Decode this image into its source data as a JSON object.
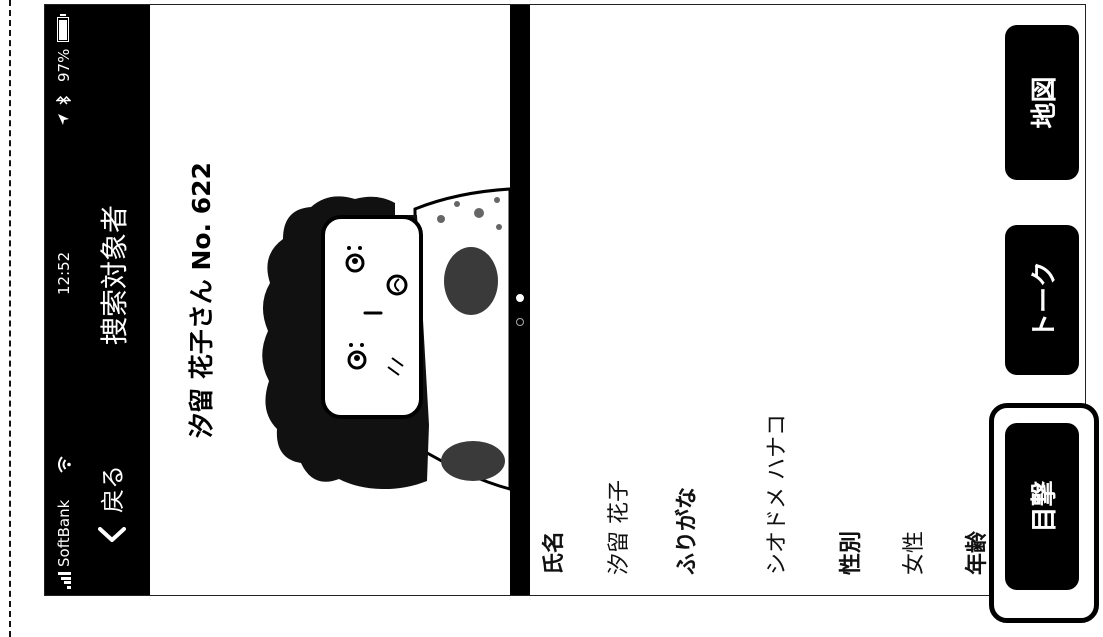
{
  "status_bar": {
    "carrier": "SoftBank",
    "time": "12:52",
    "battery_percent": "97%",
    "battery_level": 0.97,
    "icons": [
      "signal-icon",
      "wifi-icon",
      "location-arrow-icon",
      "bluetooth-icon",
      "battery-icon"
    ]
  },
  "nav": {
    "back_label": "戻る",
    "back_icon": "back-chevron-icon",
    "title": "捜索対象者"
  },
  "profile": {
    "heading": "汐留 花子さん No. 622",
    "page_count": 2,
    "active_page": 2
  },
  "details": [
    {
      "label": "氏名",
      "value": "汐留 花子"
    },
    {
      "label": "ふりがな",
      "value": "シオドメ ハナコ"
    },
    {
      "label": "性別",
      "value": "女性"
    },
    {
      "label": "年齢"
    }
  ],
  "toolbar": {
    "sighting_label": "目撃",
    "talk_label": "トーク",
    "map_label": "地図",
    "sighting_highlighted": true
  },
  "colors": {
    "header_bg": "#000000",
    "header_text": "#ffffff",
    "button_bg": "#000000",
    "button_text": "#ffffff",
    "body_spot": "#3a3a3a"
  }
}
